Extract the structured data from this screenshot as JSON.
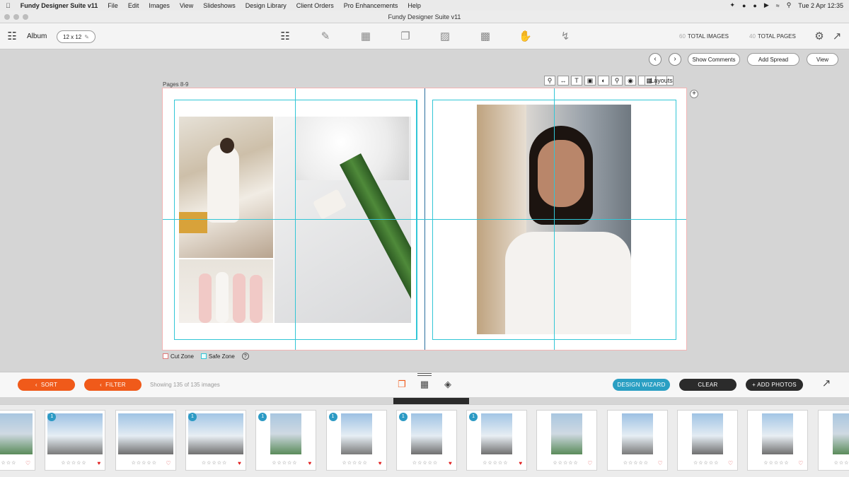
{
  "menubar": {
    "app": "Fundy Designer Suite v11",
    "items": [
      "File",
      "Edit",
      "Images",
      "View",
      "Slideshows",
      "Design Library",
      "Client Orders",
      "Pro Enhancements",
      "Help"
    ],
    "clock": "Tue 2 Apr  12:35"
  },
  "window": {
    "title": "Fundy Designer Suite v11"
  },
  "toolbar": {
    "product": "Album",
    "size": "12 x 12",
    "total_images_count": "60",
    "total_images_label": "TOTAL IMAGES",
    "total_pages_count": "40",
    "total_pages_label": "TOTAL PAGES"
  },
  "actions": {
    "show_comments": "Show Comments",
    "add_spread": "Add Spread",
    "view": "View"
  },
  "canvas": {
    "pages_label": "Pages 8-9",
    "layouts": "Layouts",
    "cut_zone": "Cut Zone",
    "safe_zone": "Safe Zone"
  },
  "bottom": {
    "sort": "SORT",
    "filter": "FILTER",
    "showing": "Showing 135 of 135 images",
    "design_wizard": "DESIGN WIZARD",
    "clear": "CLEAR",
    "add_photos": "+ ADD PHOTOS"
  },
  "colors": {
    "orange": "#f05a1a",
    "teal": "#2a9fc3",
    "dark": "#2b2b2b",
    "guide": "#31c6d6"
  },
  "thumbnails": [
    {
      "badge": "",
      "heart": "outline"
    },
    {
      "badge": "1",
      "heart": "filled"
    },
    {
      "badge": "",
      "heart": "outline"
    },
    {
      "badge": "1",
      "heart": "filled"
    },
    {
      "badge": "1",
      "heart": "filled"
    },
    {
      "badge": "1",
      "heart": "filled"
    },
    {
      "badge": "1",
      "heart": "filled"
    },
    {
      "badge": "1",
      "heart": "filled"
    },
    {
      "badge": "",
      "heart": "outline"
    },
    {
      "badge": "",
      "heart": "outline"
    },
    {
      "badge": "",
      "heart": "outline"
    },
    {
      "badge": "",
      "heart": "outline"
    },
    {
      "badge": "",
      "heart": "outline"
    }
  ]
}
